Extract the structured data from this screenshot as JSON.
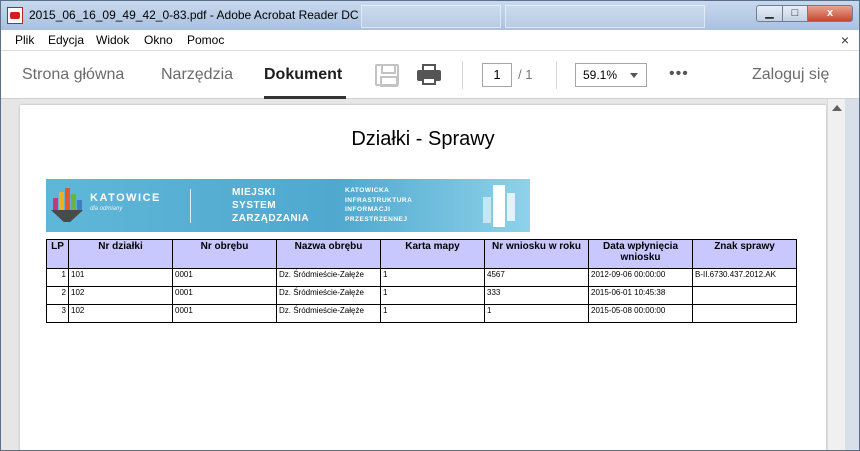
{
  "window": {
    "title": "2015_06_16_09_49_42_0-83.pdf - Adobe Acrobat Reader DC",
    "controls": {
      "minimize": "▁",
      "maximize": "□",
      "close": "x"
    }
  },
  "menu": {
    "items": [
      "Plik",
      "Edycja",
      "Widok",
      "Okno",
      "Pomoc"
    ],
    "close_glyph": "×"
  },
  "toolbar": {
    "tabs": [
      {
        "label": "Strona główna",
        "active": false
      },
      {
        "label": "Narzędzia",
        "active": false
      },
      {
        "label": "Dokument",
        "active": true
      }
    ],
    "page_current": "1",
    "page_total": "/ 1",
    "zoom": "59.1%",
    "more": "•••",
    "login": "Zaloguj się"
  },
  "document": {
    "title": "Działki - Sprawy",
    "banner": {
      "city": "KATOWICE",
      "tagline": "dla odmiany",
      "system_lines": [
        "MIEJSKI",
        "SYSTEM",
        "ZARZĄDZANIA"
      ],
      "kiip_lines": [
        "KATOWICKA",
        "INFRASTRUKTURA",
        "INFORMACJI",
        "PRZESTRZENNEJ"
      ]
    },
    "table": {
      "headers": [
        "LP",
        "Nr działki",
        "Nr obrębu",
        "Nazwa obrębu",
        "Karta mapy",
        "Nr wniosku w roku",
        "Data wpłynięcia wniosku",
        "Znak sprawy"
      ],
      "rows": [
        [
          "1",
          "101",
          "0001",
          "Dz. Śródmieście-Załęże",
          "1",
          "4567",
          "2012-09-06 00:00:00",
          "B-II.6730.437.2012.AK"
        ],
        [
          "2",
          "102",
          "0001",
          "Dz. Śródmieście-Załęże",
          "1",
          "333",
          "2015-06-01 10:45:38",
          ""
        ],
        [
          "3",
          "102",
          "0001",
          "Dz. Śródmieście-Załęże",
          "1",
          "1",
          "2015-05-08 00:00:00",
          ""
        ]
      ]
    }
  }
}
